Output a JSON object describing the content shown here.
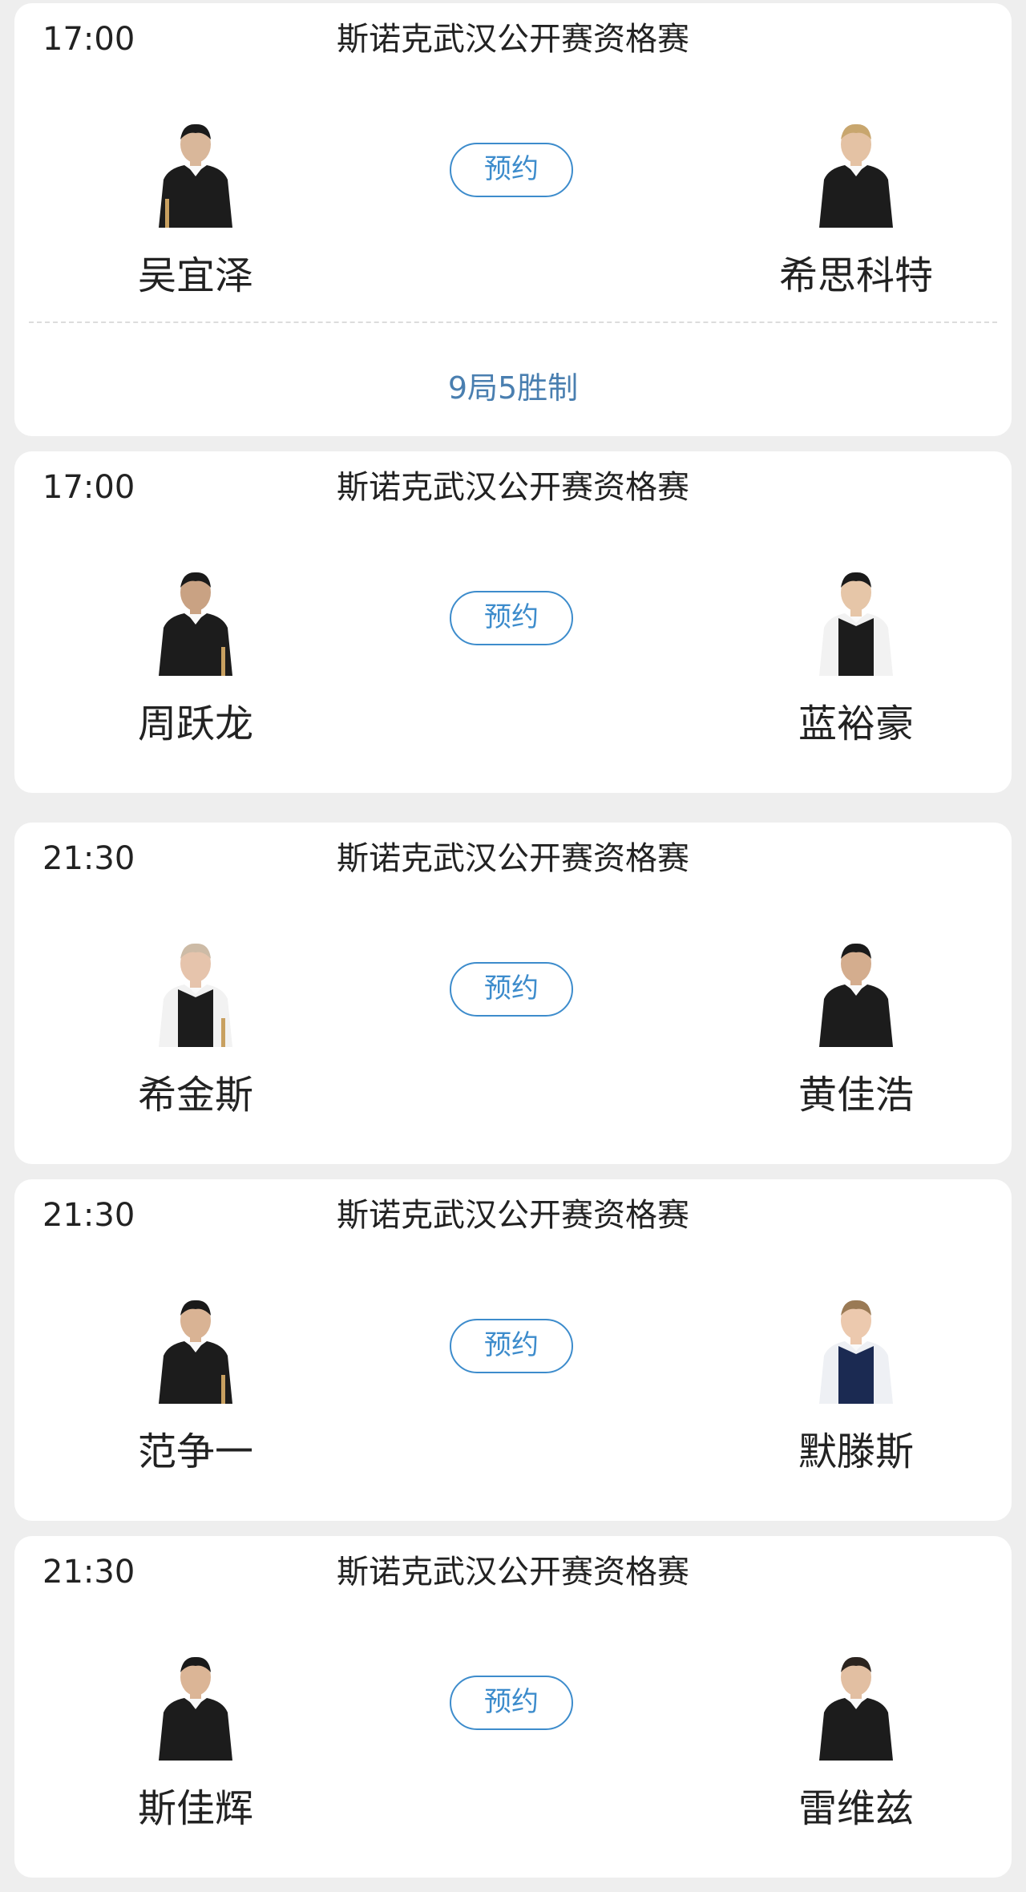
{
  "reserve_label": "预约",
  "matches": [
    {
      "time": "17:00",
      "competition": "斯诺克武汉公开赛资格赛",
      "player1": {
        "name": "吴宜泽"
      },
      "player2": {
        "name": "希思科特"
      },
      "format": "9局5胜制"
    },
    {
      "time": "17:00",
      "competition": "斯诺克武汉公开赛资格赛",
      "player1": {
        "name": "周跃龙"
      },
      "player2": {
        "name": "蓝裕豪"
      }
    },
    {
      "time": "21:30",
      "competition": "斯诺克武汉公开赛资格赛",
      "player1": {
        "name": "希金斯"
      },
      "player2": {
        "name": "黄佳浩"
      }
    },
    {
      "time": "21:30",
      "competition": "斯诺克武汉公开赛资格赛",
      "player1": {
        "name": "范争一"
      },
      "player2": {
        "name": "默滕斯"
      }
    },
    {
      "time": "21:30",
      "competition": "斯诺克武汉公开赛资格赛",
      "player1": {
        "name": "斯佳辉"
      },
      "player2": {
        "name": "雷维兹"
      }
    }
  ],
  "colors": {
    "accent": "#3d8ccc",
    "format_text": "#4a7fb0",
    "page_background": "#eeeeee",
    "card_background": "#ffffff"
  }
}
